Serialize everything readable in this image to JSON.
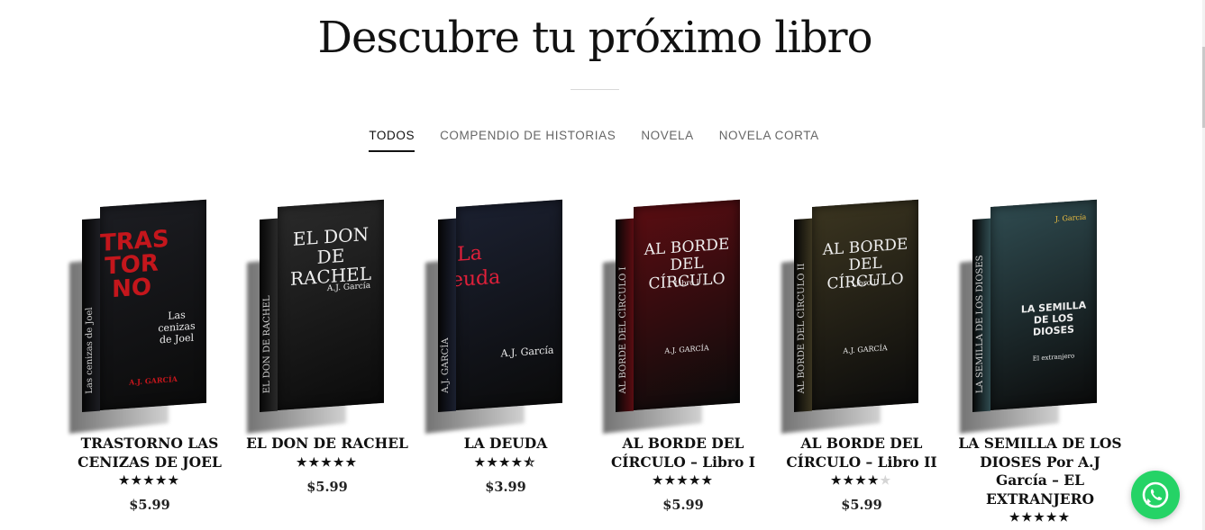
{
  "heading": "Descubre tu próximo libro",
  "tabs": [
    {
      "label": "TODOS",
      "active": true
    },
    {
      "label": "COMPENDIO DE HISTORIAS",
      "active": false
    },
    {
      "label": "NOVELA",
      "active": false
    },
    {
      "label": "NOVELA CORTA",
      "active": false
    }
  ],
  "products": [
    {
      "name": "TRASTORNO LAS CENIZAS DE JOEL",
      "rating": 5,
      "price": "$5.99",
      "cover": {
        "bg": "#1c1d22",
        "accent": "#c4161c",
        "title": "TRAS TOR NO",
        "subtitle": "Las cenizas de Joel",
        "author": "A.J. GARCÍA",
        "spine": "Las cenizas de Joel"
      }
    },
    {
      "name": "EL DON DE RACHEL",
      "rating": 5,
      "price": "$5.99",
      "cover": {
        "bg": "#2a2a2a",
        "accent": "#e6e6e6",
        "title": "EL DON DE RACHEL",
        "subtitle": "",
        "author": "A.J. García",
        "spine": "EL DON DE RACHEL"
      }
    },
    {
      "name": "LA DEUDA",
      "rating": 4.5,
      "price": "$3.99",
      "cover": {
        "bg": "#1b2030",
        "accent": "#e0203a",
        "title": "La deuda",
        "subtitle": "",
        "author": "A.J. García",
        "spine": "A.J. GARCÍA"
      }
    },
    {
      "name": "AL BORDE DEL CÍRCULO – Libro I",
      "rating": 5,
      "price": "$5.99",
      "cover": {
        "bg": "#5a0d12",
        "accent": "#f0f0f0",
        "title": "AL BORDE DEL CÍRCULO",
        "subtitle": "Libro I",
        "author": "A.J. GARCÍA",
        "spine": "AL BORDE DEL CÍRCULO I"
      }
    },
    {
      "name": "AL BORDE DEL CÍRCULO – Libro II",
      "rating": 4,
      "price": "$5.99",
      "cover": {
        "bg": "#3b3520",
        "accent": "#f0efe0",
        "title": "AL BORDE DEL CÍRCULO",
        "subtitle": "Libro II",
        "author": "A.J. GARCÍA",
        "spine": "AL BORDE DEL CÍRCULO II"
      }
    },
    {
      "name": "LA SEMILLA DE LOS DIOSES Por A.J García – EL EXTRANJERO",
      "rating": 5,
      "price": "",
      "cover": {
        "bg": "#2f4b50",
        "accent": "#ffffff",
        "title": "LA SEMILLA DE LOS DIOSES",
        "subtitle": "El extranjero",
        "author": "J. García",
        "spine": "LA SEMILLA DE LOS DIOSES"
      }
    }
  ],
  "colors": {
    "whatsapp": "#25d366",
    "text": "#111111",
    "tab_inactive": "#666666"
  },
  "icons": {
    "whatsapp": "whatsapp-icon"
  }
}
